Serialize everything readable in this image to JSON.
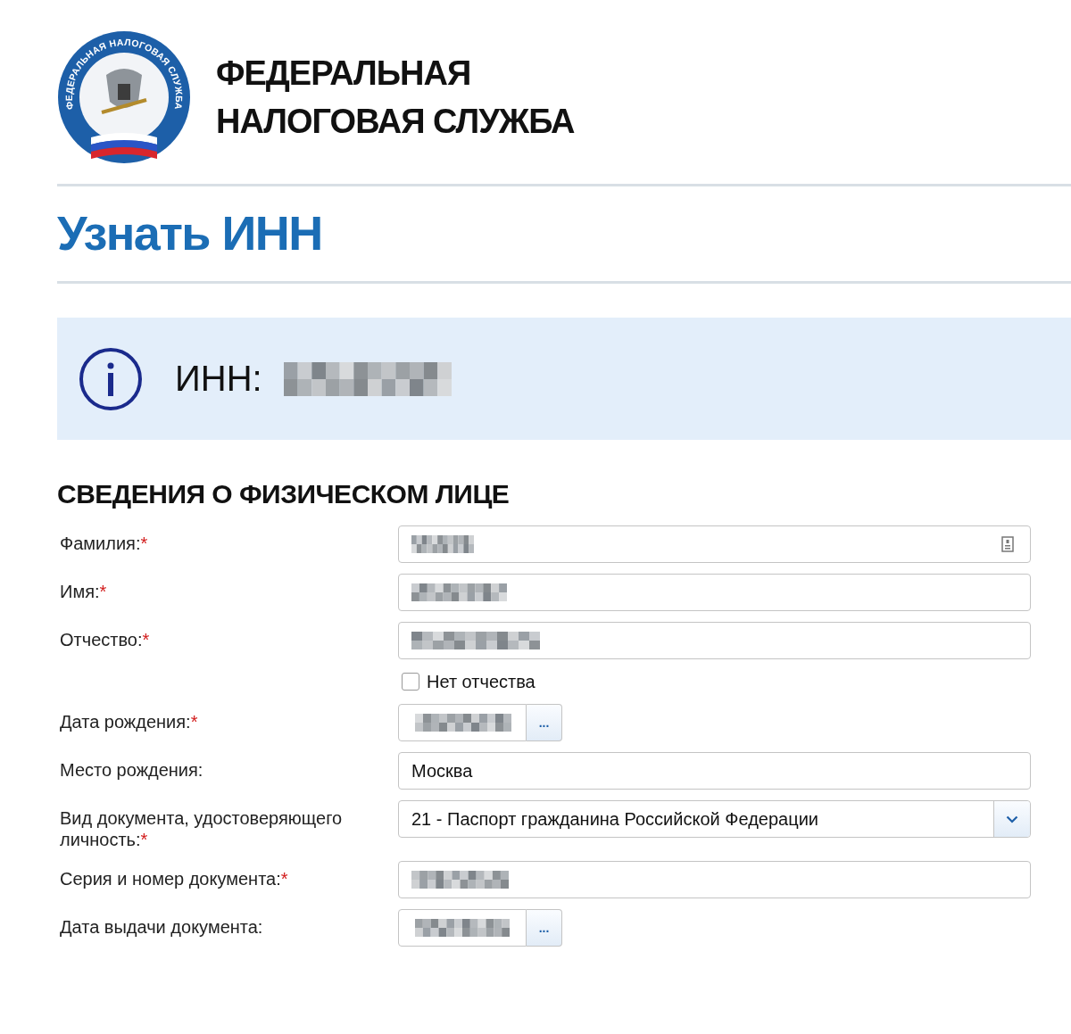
{
  "header": {
    "logo_ring_text": "ФЕДЕРАЛЬНАЯ НАЛОГОВАЯ СЛУЖБА",
    "title_lines": [
      "ФЕДЕРАЛЬНАЯ",
      "НАЛОГОВАЯ СЛУЖБА"
    ]
  },
  "page_title": "Узнать ИНН",
  "result": {
    "label": "ИНН:",
    "blurred": true
  },
  "section_title": "СВЕДЕНИЯ О ФИЗИЧЕСКОМ ЛИЦЕ",
  "fields": [
    {
      "kind": "text",
      "label": "Фамилия:",
      "required_mark": "*",
      "blurred": true,
      "card_icon": true
    },
    {
      "kind": "text",
      "label": "Имя:",
      "required_mark": "*",
      "blurred": true
    },
    {
      "kind": "text",
      "label": "Отчество:",
      "required_mark": "*",
      "blurred": true
    },
    {
      "kind": "checkbox",
      "label": "Нет отчества",
      "checked": false
    },
    {
      "kind": "date",
      "label": "Дата рождения:",
      "required_mark": "*",
      "blurred": true,
      "button": "..."
    },
    {
      "kind": "text",
      "label": "Место рождения:",
      "value": "Москва"
    },
    {
      "kind": "select",
      "label": "Вид документа, удостоверяющего личность:",
      "required_mark": "*",
      "value": "21 - Паспорт гражданина Российской Федерации"
    },
    {
      "kind": "text",
      "label": "Серия и номер документа:",
      "required_mark": "*",
      "blurred": true
    },
    {
      "kind": "date",
      "label": "Дата выдачи документа:",
      "blurred": true,
      "button": "..."
    }
  ]
}
